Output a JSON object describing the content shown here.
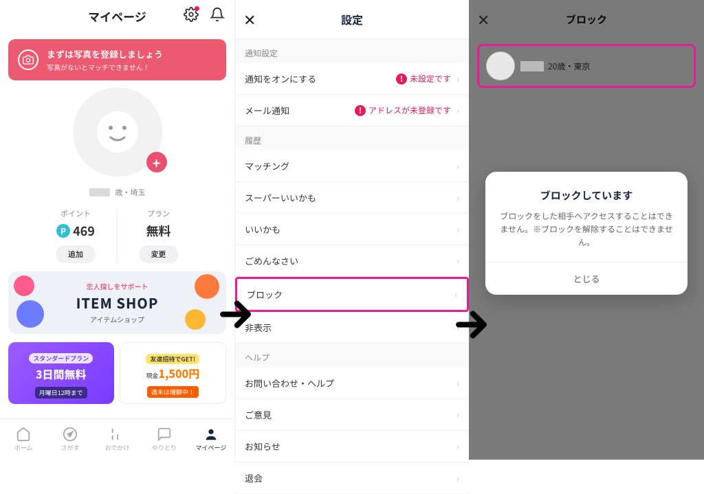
{
  "panel1": {
    "title": "マイページ",
    "banner": {
      "title": "まずは写真を登録しましょう",
      "sub": "写真がないとマッチできません！"
    },
    "profile": {
      "meta": "歳・埼玉"
    },
    "stats": {
      "points": {
        "label": "ポイント",
        "value": "469",
        "action": "追加"
      },
      "plan": {
        "label": "プラン",
        "value": "無料",
        "action": "変更"
      }
    },
    "itemshop": {
      "pre": "恋人探しをサポート",
      "title": "ITEM SHOP",
      "sub": "アイテムショップ"
    },
    "promo1": {
      "badge": "スタンダードプラン",
      "big": "3日間無料",
      "sub": "月曜日12時まで"
    },
    "promo2": {
      "badge": "友達招待でGET!",
      "pre": "現金",
      "big": "1,500円",
      "sub": "週末は増額中！"
    },
    "tabs": [
      "ホーム",
      "さがす",
      "おでかけ",
      "やりとり",
      "マイページ"
    ]
  },
  "panel2": {
    "title": "設定",
    "sections": {
      "notify": {
        "header": "通知設定",
        "items": [
          {
            "label": "通知をオンにする",
            "warn": "未設定です"
          },
          {
            "label": "メール通知",
            "warn": "アドレスが未登録です"
          }
        ]
      },
      "history": {
        "header": "履歴",
        "items": [
          {
            "label": "マッチング"
          },
          {
            "label": "スーパーいいかも"
          },
          {
            "label": "いいかも"
          },
          {
            "label": "ごめんなさい"
          },
          {
            "label": "ブロック",
            "highlight": true
          },
          {
            "label": "非表示"
          }
        ]
      },
      "help": {
        "header": "ヘルプ",
        "items": [
          {
            "label": "お問い合わせ・ヘルプ"
          },
          {
            "label": "ご意見"
          },
          {
            "label": "お知らせ"
          },
          {
            "label": "退会"
          }
        ]
      }
    }
  },
  "panel3": {
    "title": "ブロック",
    "blocked": {
      "meta": "20歳・東京"
    },
    "modal": {
      "title": "ブロックしています",
      "text": "ブロックをした相手へアクセスすることはできません。※ブロックを解除することはできません。",
      "btn": "とじる"
    }
  }
}
